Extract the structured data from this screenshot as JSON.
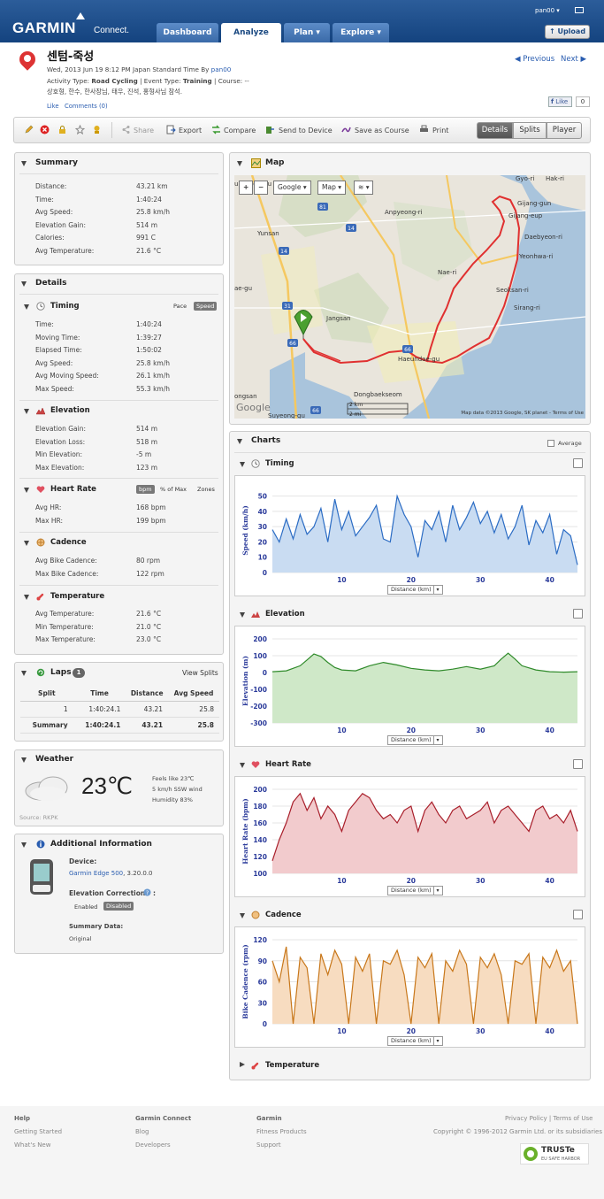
{
  "header": {
    "logo": "GARMIN",
    "logo_sub": "Connect.",
    "nav": [
      "Dashboard",
      "Analyze",
      "Plan ▾",
      "Explore ▾"
    ],
    "user": "pan00 ▾",
    "upload": "Upload"
  },
  "activity": {
    "title": "센텀-죽성",
    "date_line": "Wed, 2013 Jun 19 8:12 PM Japan Standard Time By ",
    "owner": "pan00",
    "type_line_pre": "Activity Type: ",
    "type": "Road Cycling",
    "event_pre": " | Event Type: ",
    "event": "Training",
    "course_pre": " | Course: --",
    "participants": "상호형, 한수, 한사장님, 태우, 진석, 홍형사님 참석.",
    "like": "Like",
    "comments": "Comments (0)",
    "prev": "◀ Previous",
    "next": "Next ▶",
    "fb_like": "Like",
    "fb_count": "0"
  },
  "toolbar": {
    "items": [
      "Share",
      "Export",
      "Compare",
      "Send to Device",
      "Save as Course",
      "Print"
    ],
    "views": [
      "Details",
      "Splits",
      "Player"
    ]
  },
  "summary": {
    "title": "Summary",
    "rows": [
      {
        "label": "Distance:",
        "value": "43.21 km"
      },
      {
        "label": "Time:",
        "value": "1:40:24"
      },
      {
        "label": "Avg Speed:",
        "value": "25.8 km/h"
      },
      {
        "label": "Elevation Gain:",
        "value": "514 m"
      },
      {
        "label": "Calories:",
        "value": "991 C"
      },
      {
        "label": "Avg Temperature:",
        "value": "21.6 °C"
      }
    ]
  },
  "details": {
    "title": "Details",
    "timing": {
      "title": "Timing",
      "toggle_a": "Pace",
      "toggle_b": "Speed",
      "rows": [
        {
          "label": "Time:",
          "value": "1:40:24"
        },
        {
          "label": "Moving Time:",
          "value": "1:39:27"
        },
        {
          "label": "Elapsed Time:",
          "value": "1:50:02"
        },
        {
          "label": "Avg Speed:",
          "value": "25.8 km/h"
        },
        {
          "label": "Avg Moving Speed:",
          "value": "26.1 km/h"
        },
        {
          "label": "Max Speed:",
          "value": "55.3 km/h"
        }
      ]
    },
    "elevation": {
      "title": "Elevation",
      "rows": [
        {
          "label": "Elevation Gain:",
          "value": "514 m"
        },
        {
          "label": "Elevation Loss:",
          "value": "518 m"
        },
        {
          "label": "Min Elevation:",
          "value": "-5 m"
        },
        {
          "label": "Max Elevation:",
          "value": "123 m"
        }
      ]
    },
    "heart_rate": {
      "title": "Heart Rate",
      "toggle_a": "bpm",
      "toggle_b": "% of Max",
      "toggle_c": "Zones",
      "rows": [
        {
          "label": "Avg HR:",
          "value": "168 bpm"
        },
        {
          "label": "Max HR:",
          "value": "199 bpm"
        }
      ]
    },
    "cadence": {
      "title": "Cadence",
      "rows": [
        {
          "label": "Avg Bike Cadence:",
          "value": "80 rpm"
        },
        {
          "label": "Max Bike Cadence:",
          "value": "122 rpm"
        }
      ]
    },
    "temperature": {
      "title": "Temperature",
      "rows": [
        {
          "label": "Avg Temperature:",
          "value": "21.6 °C"
        },
        {
          "label": "Min Temperature:",
          "value": "21.0 °C"
        },
        {
          "label": "Max Temperature:",
          "value": "23.0 °C"
        }
      ]
    }
  },
  "laps": {
    "title": "Laps",
    "count": "1",
    "view_splits": "View Splits",
    "columns": [
      "Split",
      "Time",
      "Distance",
      "Avg Speed"
    ],
    "rows": [
      [
        "1",
        "1:40:24.1",
        "43.21",
        "25.8"
      ],
      [
        "Summary",
        "1:40:24.1",
        "43.21",
        "25.8"
      ]
    ]
  },
  "weather": {
    "title": "Weather",
    "temp": "23℃",
    "feels": "Feels like 23℃",
    "wind": "5 km/h SSW wind",
    "humidity": "Humidity 83%",
    "source": "Source: RKPK"
  },
  "additional": {
    "title": "Additional Information",
    "device_label": "Device:",
    "device": "Garmin Edge 500",
    "device_ver": ", 3.20.0.0",
    "elev_corr": "Elevation Corrections",
    "enabled": "Enabled",
    "disabled": "Disabled",
    "summary_data": "Summary Data:",
    "original": "Original"
  },
  "map": {
    "title": "Map",
    "zoom_in": "+",
    "zoom_out": "−",
    "btn_google": "Google ▾",
    "btn_map": "Map ▾",
    "btn_layers": "▾",
    "labels": [
      "Gyo-ri",
      "Hak-ri",
      "umjeong-gu",
      "Gijang-gun",
      "Anpyeong-ri",
      "Gijang-eup",
      "Daebyeon-ri",
      "Yunsan",
      "Yeonhwa-ri",
      "Nae-ri",
      "Seoksan-ri",
      "ae-gu",
      "Sirang-ri",
      "Jangsan",
      "Haeundae-gu",
      "Dongbaekseom",
      "ongsan",
      "Suyeong-gu"
    ],
    "road_labels": [
      "81",
      "14",
      "14",
      "31",
      "66",
      "66",
      "66"
    ],
    "scale_km": "2 km",
    "scale_mi": "2 mi",
    "copyright": "Map data ©2013 Google, SK planet - Terms of Use",
    "logo": "Google"
  },
  "charts": {
    "title": "Charts",
    "average": "Average",
    "distance_dd": "Distance (km)",
    "temperature_title": "Temperature"
  },
  "chart_data": [
    {
      "type": "area",
      "title": "Timing",
      "ylabel": "Speed (km/h)",
      "xlabel": "Distance (km)",
      "xlim": [
        0,
        44
      ],
      "ylim": [
        0,
        55
      ],
      "yticks": [
        0,
        10,
        20,
        30,
        40,
        50
      ],
      "xticks": [
        10,
        20,
        30,
        40
      ],
      "color": "#2b6cc4",
      "fill": "#c9dcf2",
      "x": [
        0,
        1,
        2,
        3,
        4,
        5,
        6,
        7,
        8,
        9,
        10,
        11,
        12,
        13,
        14,
        15,
        16,
        17,
        18,
        19,
        20,
        21,
        22,
        23,
        24,
        25,
        26,
        27,
        28,
        29,
        30,
        31,
        32,
        33,
        34,
        35,
        36,
        37,
        38,
        39,
        40,
        41,
        42,
        43,
        44
      ],
      "values": [
        28,
        20,
        35,
        22,
        38,
        25,
        30,
        42,
        20,
        48,
        28,
        40,
        24,
        30,
        36,
        44,
        22,
        20,
        50,
        38,
        30,
        10,
        34,
        28,
        40,
        20,
        44,
        28,
        36,
        46,
        32,
        40,
        26,
        38,
        22,
        30,
        44,
        18,
        34,
        26,
        38,
        12,
        28,
        24,
        5
      ]
    },
    {
      "type": "area",
      "title": "Elevation",
      "ylabel": "Elevation (m)",
      "xlabel": "Distance (km)",
      "xlim": [
        0,
        44
      ],
      "ylim": [
        -300,
        200
      ],
      "yticks": [
        -300,
        -200,
        -100,
        0,
        100,
        200
      ],
      "xticks": [
        10,
        20,
        30,
        40
      ],
      "color": "#2f8a2a",
      "fill": "#cfe8c8",
      "x": [
        0,
        2,
        4,
        5,
        6,
        7,
        8,
        9,
        10,
        12,
        14,
        16,
        18,
        20,
        22,
        24,
        26,
        28,
        30,
        32,
        33,
        34,
        35,
        36,
        38,
        40,
        42,
        44
      ],
      "values": [
        5,
        10,
        40,
        75,
        110,
        95,
        60,
        30,
        15,
        10,
        40,
        60,
        45,
        25,
        15,
        10,
        20,
        35,
        20,
        40,
        80,
        115,
        80,
        40,
        15,
        5,
        2,
        5
      ]
    },
    {
      "type": "area",
      "title": "Heart Rate",
      "ylabel": "Heart Rate (bpm)",
      "xlabel": "Distance (km)",
      "xlim": [
        0,
        44
      ],
      "ylim": [
        100,
        200
      ],
      "yticks": [
        100,
        120,
        140,
        160,
        180,
        200
      ],
      "xticks": [
        10,
        20,
        30,
        40
      ],
      "color": "#a81e2a",
      "fill": "#f2cbcd",
      "x": [
        0,
        1,
        2,
        3,
        4,
        5,
        6,
        7,
        8,
        9,
        10,
        11,
        12,
        13,
        14,
        15,
        16,
        17,
        18,
        19,
        20,
        21,
        22,
        23,
        24,
        25,
        26,
        27,
        28,
        29,
        30,
        31,
        32,
        33,
        34,
        35,
        36,
        37,
        38,
        39,
        40,
        41,
        42,
        43,
        44
      ],
      "values": [
        115,
        140,
        160,
        185,
        195,
        175,
        190,
        165,
        180,
        170,
        150,
        175,
        185,
        195,
        190,
        175,
        165,
        170,
        160,
        175,
        180,
        150,
        175,
        185,
        170,
        160,
        175,
        180,
        165,
        170,
        175,
        185,
        160,
        175,
        180,
        170,
        160,
        150,
        175,
        180,
        165,
        170,
        160,
        175,
        150
      ]
    },
    {
      "type": "area",
      "title": "Cadence",
      "ylabel": "Bike Cadence (rpm)",
      "xlabel": "Distance (km)",
      "xlim": [
        0,
        44
      ],
      "ylim": [
        0,
        120
      ],
      "yticks": [
        0,
        30,
        60,
        90,
        120
      ],
      "xticks": [
        10,
        20,
        30,
        40
      ],
      "color": "#c8771a",
      "fill": "#f7dcc0",
      "x": [
        0,
        1,
        2,
        3,
        4,
        5,
        6,
        7,
        8,
        9,
        10,
        11,
        12,
        13,
        14,
        15,
        16,
        17,
        18,
        19,
        20,
        21,
        22,
        23,
        24,
        25,
        26,
        27,
        28,
        29,
        30,
        31,
        32,
        33,
        34,
        35,
        36,
        37,
        38,
        39,
        40,
        41,
        42,
        43,
        44
      ],
      "values": [
        90,
        60,
        110,
        0,
        95,
        80,
        0,
        100,
        70,
        105,
        85,
        0,
        95,
        75,
        100,
        0,
        90,
        85,
        105,
        70,
        0,
        95,
        80,
        100,
        0,
        90,
        75,
        105,
        85,
        0,
        95,
        80,
        100,
        70,
        0,
        90,
        85,
        100,
        0,
        95,
        80,
        105,
        75,
        90,
        0
      ]
    }
  ],
  "footer": {
    "help": "Help",
    "help_links": [
      "Getting Started",
      "What's New"
    ],
    "gc": "Garmin Connect",
    "gc_links": [
      "Blog",
      "Developers"
    ],
    "garmin": "Garmin",
    "garmin_links": [
      "Fitness Products",
      "Support"
    ],
    "policy": "Privacy Policy | Terms of Use",
    "copyright": "Copyright © 1996-2012 Garmin Ltd. or its subsidiaries",
    "truste": "TRUSTe",
    "truste_sub": "EU SAFE HARBOR"
  }
}
